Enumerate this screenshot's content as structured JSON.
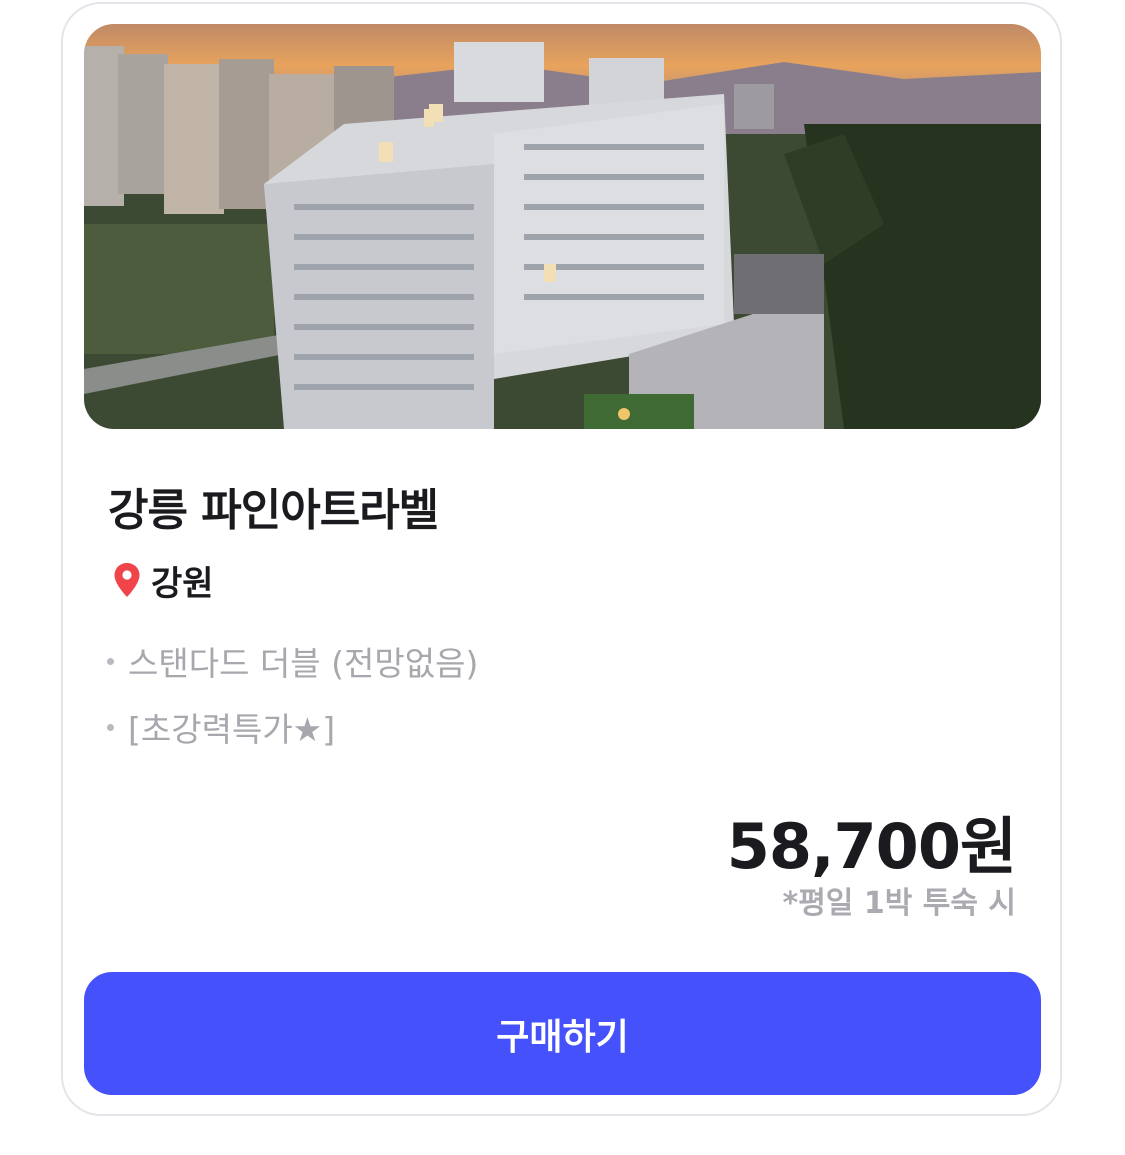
{
  "product": {
    "title": "강릉 파인아트라벨",
    "location": "강원",
    "options": [
      "스탠다드 더블 (전망없음)",
      "[초강력특가★]"
    ],
    "price": "58,700원",
    "price_note": "*평일 1박 투숙 시"
  },
  "actions": {
    "buy_label": "구매하기"
  },
  "colors": {
    "accent": "#4551fb",
    "pin": "#f0434a",
    "title": "#1b1b1f",
    "muted": "#a7a7ad"
  },
  "icons": {
    "location": "location-pin-icon"
  }
}
